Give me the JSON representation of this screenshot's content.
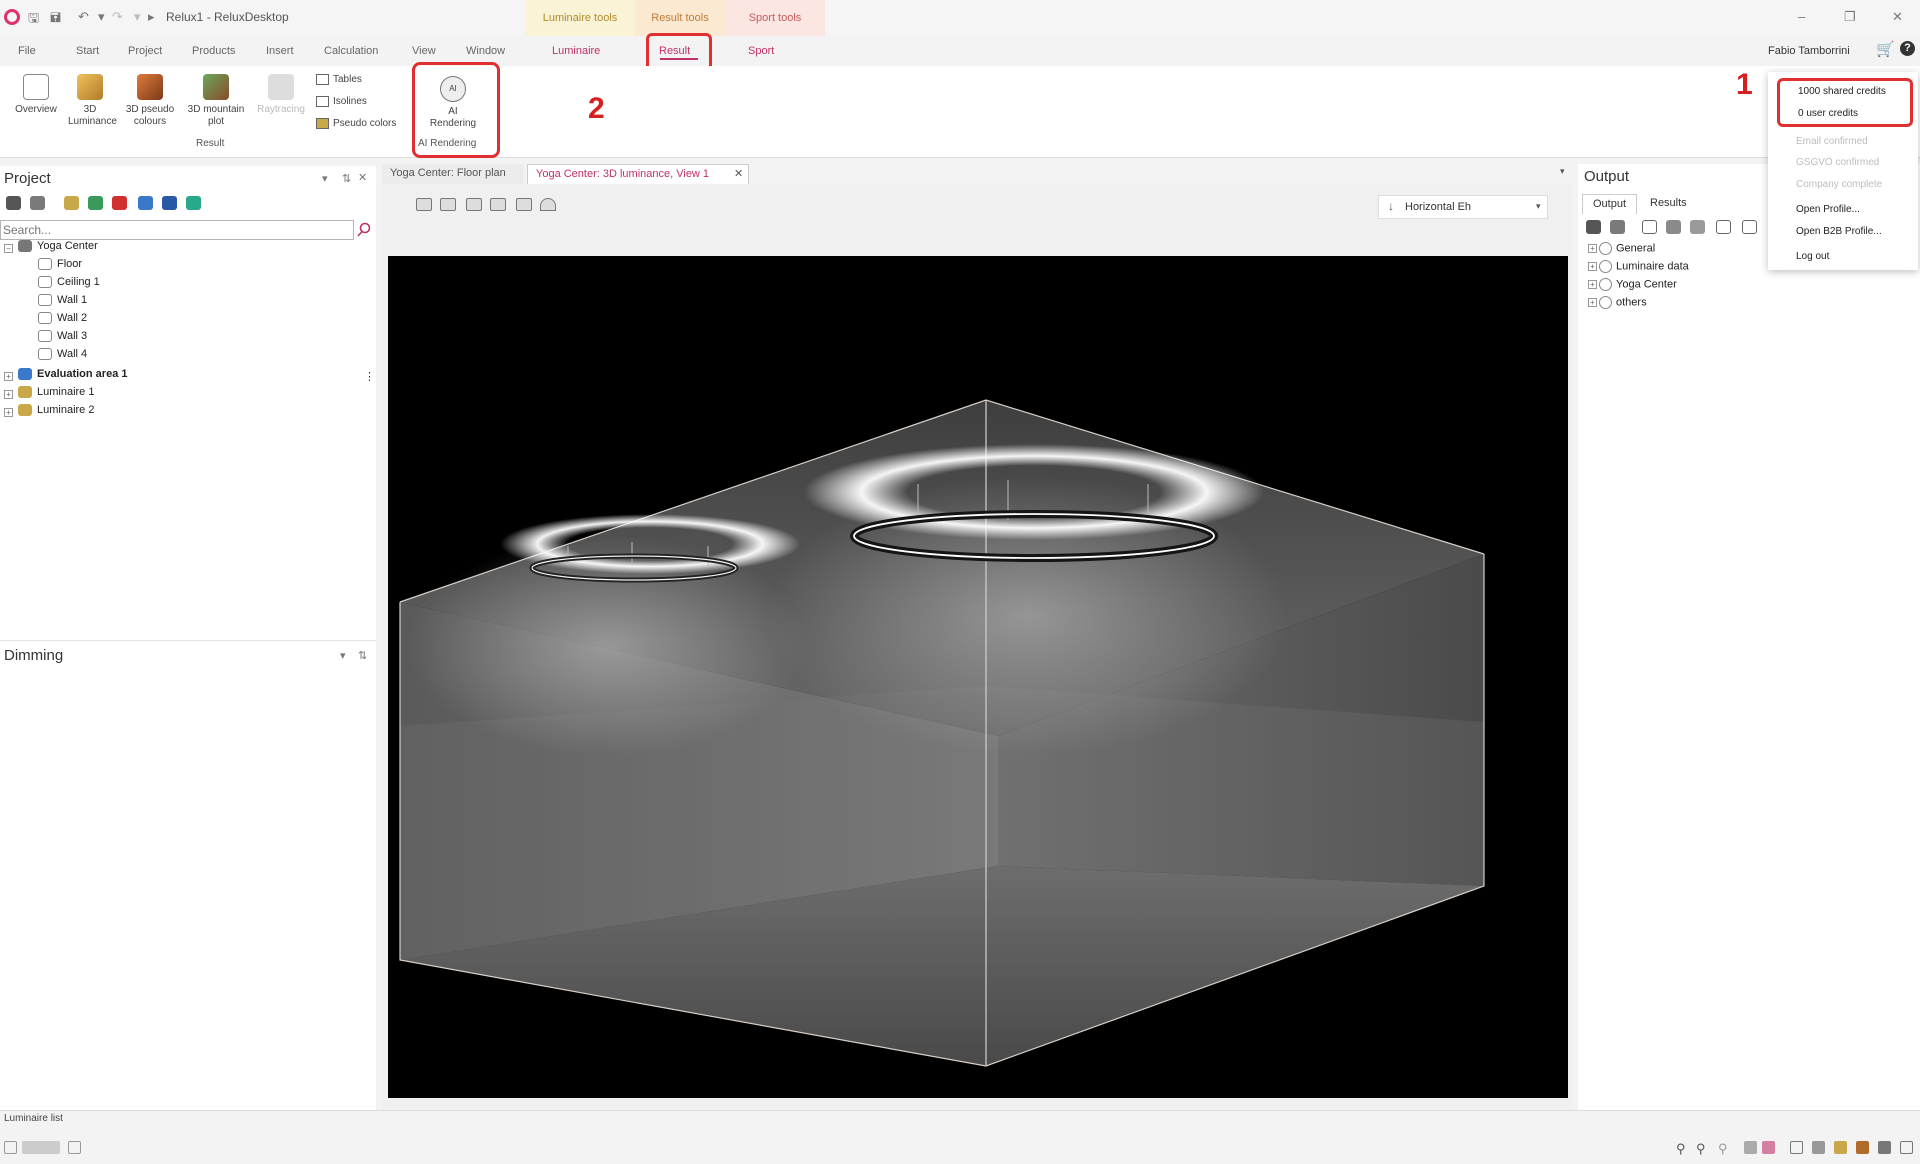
{
  "window": {
    "title": "Relux1 - ReluxDesktop",
    "contextual_tabs": [
      "Luminaire tools",
      "Result tools",
      "Sport tools"
    ]
  },
  "menu": {
    "items": [
      "File",
      "Start",
      "Project",
      "Products",
      "Insert",
      "Calculation",
      "View",
      "Window"
    ],
    "context_items": [
      "Luminaire",
      "Result",
      "Sport"
    ],
    "active": "Result"
  },
  "user": {
    "name": "Fabio Tamborrini",
    "dropdown": {
      "shared_credits": "1000 shared credits",
      "user_credits": "0 user credits",
      "disabled_items": [
        "Email confirmed",
        "GSGVO confirmed",
        "Company complete"
      ],
      "actions": [
        "Open Profile...",
        "Open B2B Profile...",
        "Log out"
      ]
    }
  },
  "ribbon": {
    "buttons": [
      {
        "label": "Overview",
        "icon": "overview-icon"
      },
      {
        "label": "3D Luminance",
        "icon": "3d-luminance-icon"
      },
      {
        "label": "3D pseudo colours",
        "icon": "3d-pseudo-colours-icon"
      },
      {
        "label": "3D mountain plot",
        "icon": "3d-mountain-plot-icon"
      },
      {
        "label": "Raytracing",
        "icon": "raytracing-icon",
        "disabled": true
      }
    ],
    "small_buttons": [
      "Tables",
      "Isolines",
      "Pseudo colors"
    ],
    "group_label": "Result",
    "ai_button": "AI Rendering",
    "ai_group_label": "AI Rendering"
  },
  "annotations": {
    "one": "1",
    "two": "2"
  },
  "project_panel": {
    "title": "Project",
    "search_placeholder": "Search...",
    "tree": [
      {
        "label": "Yoga Center",
        "level": 0,
        "expanded": true
      },
      {
        "label": "Floor",
        "level": 1
      },
      {
        "label": "Ceiling 1",
        "level": 1
      },
      {
        "label": "Wall 1",
        "level": 1
      },
      {
        "label": "Wall 2",
        "level": 1
      },
      {
        "label": "Wall 3",
        "level": 1
      },
      {
        "label": "Wall 4",
        "level": 1
      },
      {
        "label": "Evaluation area 1",
        "level": 0,
        "bold": true
      },
      {
        "label": "Luminaire 1",
        "level": 0
      },
      {
        "label": "Luminaire 2",
        "level": 0
      }
    ]
  },
  "dimming_panel": {
    "title": "Dimming"
  },
  "document": {
    "tabs": [
      {
        "label": "Yoga Center: Floor plan",
        "active": false
      },
      {
        "label": "Yoga Center: 3D luminance, View 1",
        "active": true
      }
    ],
    "view_mode": "Horizontal Eh"
  },
  "output_panel": {
    "title": "Output",
    "tabs": [
      "Output",
      "Results"
    ],
    "tree": [
      "General",
      "Luminaire data",
      "Yoga Center",
      "others"
    ]
  },
  "statusbar": {
    "label": "Luminaire list"
  },
  "colors": {
    "accent": "#c0306a",
    "annotation": "#e03030",
    "context_luminaire": "#b08b2a",
    "context_result": "#c07a35",
    "context_sport": "#c95a5a"
  }
}
